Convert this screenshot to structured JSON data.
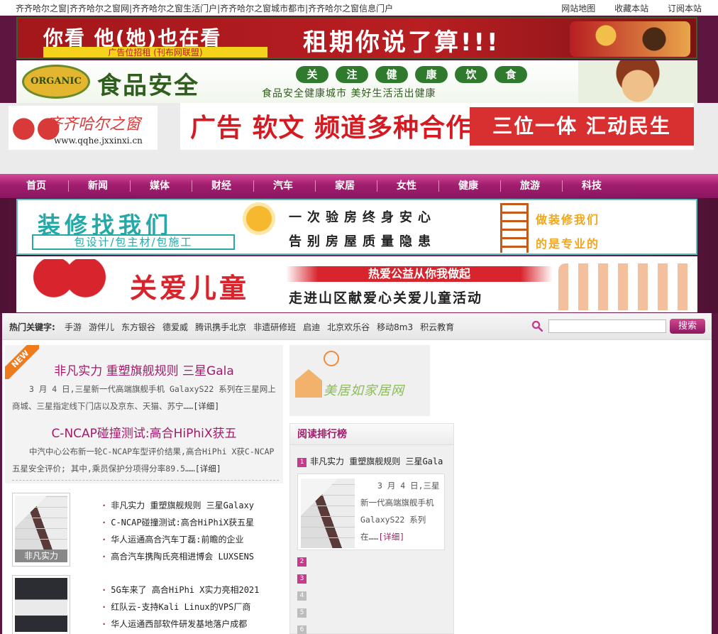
{
  "topbar": {
    "sites": "齐齐哈尔之窗|齐齐哈尔之窗网|齐齐哈尔之窗生活门户|齐齐哈尔之窗城市都市|齐齐哈尔之窗信息门户",
    "links": [
      "网站地图",
      "收藏本站",
      "订阅本站"
    ]
  },
  "ads": {
    "a1_left": "你看 他(她)也在看",
    "a1_tag": "广告位招租 (刊布网联盟)",
    "a1_right": "租期你说了算!!!",
    "a2_logo": "ORGANIC",
    "a2_title": "食品安全",
    "a2_pills": [
      "关",
      "注",
      "健",
      "康",
      "饮",
      "食"
    ],
    "a2_sub": "食品安全健康城市 美好生活活出健康",
    "a3_title": "装修找我们",
    "a3_sub": "包设计/包主材/包施工",
    "a3_line1": "一次验房终身安心",
    "a3_line2": "告别房屋质量隐患",
    "a3_right1": "做装修我们",
    "a3_right2": "的是专业的",
    "a4_title": "关爱儿童",
    "a4_ribbon": "热爱公益从你我做起",
    "a4_sub": "走进山区献爱心关爱儿童活动"
  },
  "header": {
    "site_name": "齐齐哈尔之窗",
    "site_url": "www.qqhe.jxxinxi.cn",
    "ad_left": "广告 软文 频道多种合作形式",
    "ad_right": "三位一体 汇动民生"
  },
  "nav": [
    "首页",
    "新闻",
    "媒体",
    "财经",
    "汽车",
    "家居",
    "女性",
    "健康",
    "旅游",
    "科技"
  ],
  "hot": {
    "label": "热门关键字:",
    "keywords": [
      "手游",
      "游伴儿",
      "东方银谷",
      "德爱威",
      "腾讯携手北京",
      "非遗研修班",
      "启迪",
      "北京欢乐谷",
      "移动8m3",
      "积云教育"
    ],
    "search_placeholder": "",
    "search_button": "搜索"
  },
  "featured": {
    "newtag": "NEW",
    "a1_title": "非凡实力 重塑旗舰规则 三星Gala",
    "a1_summary": "3 月 4 日,三星新一代高端旗舰手机 GalaxyS22 系列在三星网上商城、三星指定线下门店以及京东、天猫、苏宁……",
    "a2_title": "C-NCAP碰撞测试:高合HiPhiX获五",
    "a2_summary": "中汽中心公布新一轮C-NCAP车型评价结果,高合HiPhi X获C-NCAP五星安全评价; 其中,乘员保护分项得分率89.5……",
    "more": "[详细]"
  },
  "thumb1_caption": "非凡实力",
  "list1": [
    "非凡实力 重塑旗舰规则 三星Galaxy",
    "C-NCAP碰撞测试:高合HiPhiX获五星",
    "华人运通高合汽车丁磊:前瞻的企业",
    "高合汽车携陶氏亮相进博会 LUXSENS"
  ],
  "list2": [
    "5G车来了 高合HiPhi X实力亮相2021",
    "红队云-支持Kali Linux的VPS厂商",
    "华人运通西部软件研发基地落户成都"
  ],
  "home_logo": "美居如家居网",
  "rank": {
    "title": "阅读排行榜",
    "first_title": "非凡实力 重塑旗舰规则 三星Gala",
    "first_summary": "3 月 4 日,三星新一代高端旗舰手机 GalaxyS22 系列在……",
    "more": "[详细]",
    "numbers": [
      "1",
      "2",
      "3",
      "4",
      "5",
      "6"
    ]
  }
}
